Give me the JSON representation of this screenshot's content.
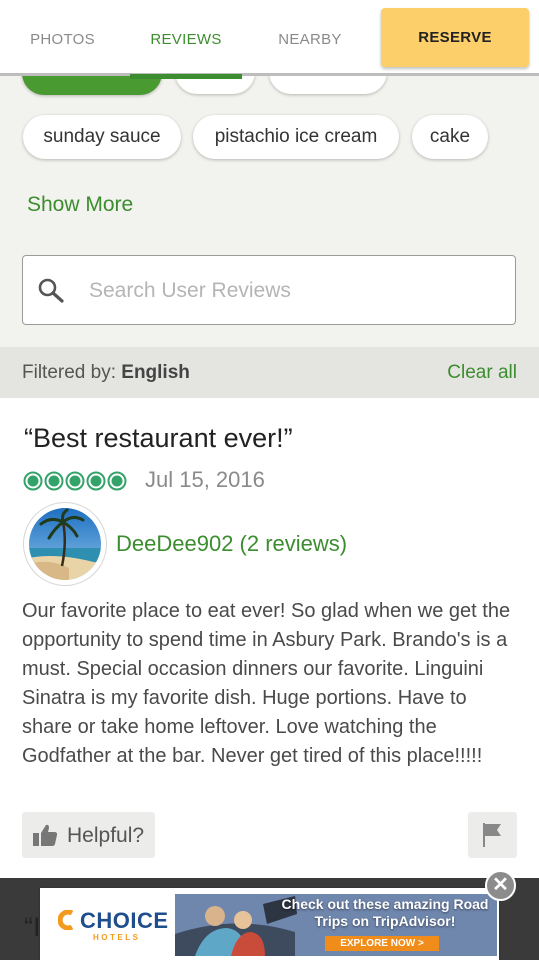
{
  "tabs": [
    {
      "label": "PHOTOS",
      "active": false
    },
    {
      "label": "REVIEWS",
      "active": true
    },
    {
      "label": "NEARBY",
      "active": false
    }
  ],
  "reserve_label": "RESERVE",
  "keyword_chips": {
    "row1": [
      "",
      "",
      ""
    ],
    "row2": [
      "sunday sauce",
      "pistachio ice cream",
      "cake"
    ]
  },
  "show_more_label": "Show More",
  "search": {
    "placeholder": "Search User Reviews",
    "value": ""
  },
  "filter": {
    "prefix": "Filtered by:",
    "value": "English",
    "clear_label": "Clear all"
  },
  "review": {
    "title": "“Best restaurant ever!”",
    "rating": 5,
    "rating_max": 5,
    "date": "Jul 15, 2016",
    "reviewer": "DeeDee902 (2 reviews)",
    "body": "Our favorite place to eat ever! So glad when we get the opportunity to spend time in Asbury Park. Brando's is a must. Special occasion dinners our favorite. Linguini Sinatra is my favorite dish. Huge portions. Have to share or take home leftover. Love watching the Godfather at the bar. Never get tired of this place!!!!!",
    "helpful_label": "Helpful?"
  },
  "next_review_peek": "“I",
  "ad": {
    "brand": "CHOICE",
    "brand_sub": "HOTELS",
    "headline": "Check out these amazing Road Trips on TripAdvisor!",
    "cta": "EXPLORE NOW >",
    "close_symbol": "✕"
  },
  "colors": {
    "accent_green": "#3c8d2f",
    "reserve_yellow": "#fdcf6a",
    "rating_green": "#34a36a"
  }
}
